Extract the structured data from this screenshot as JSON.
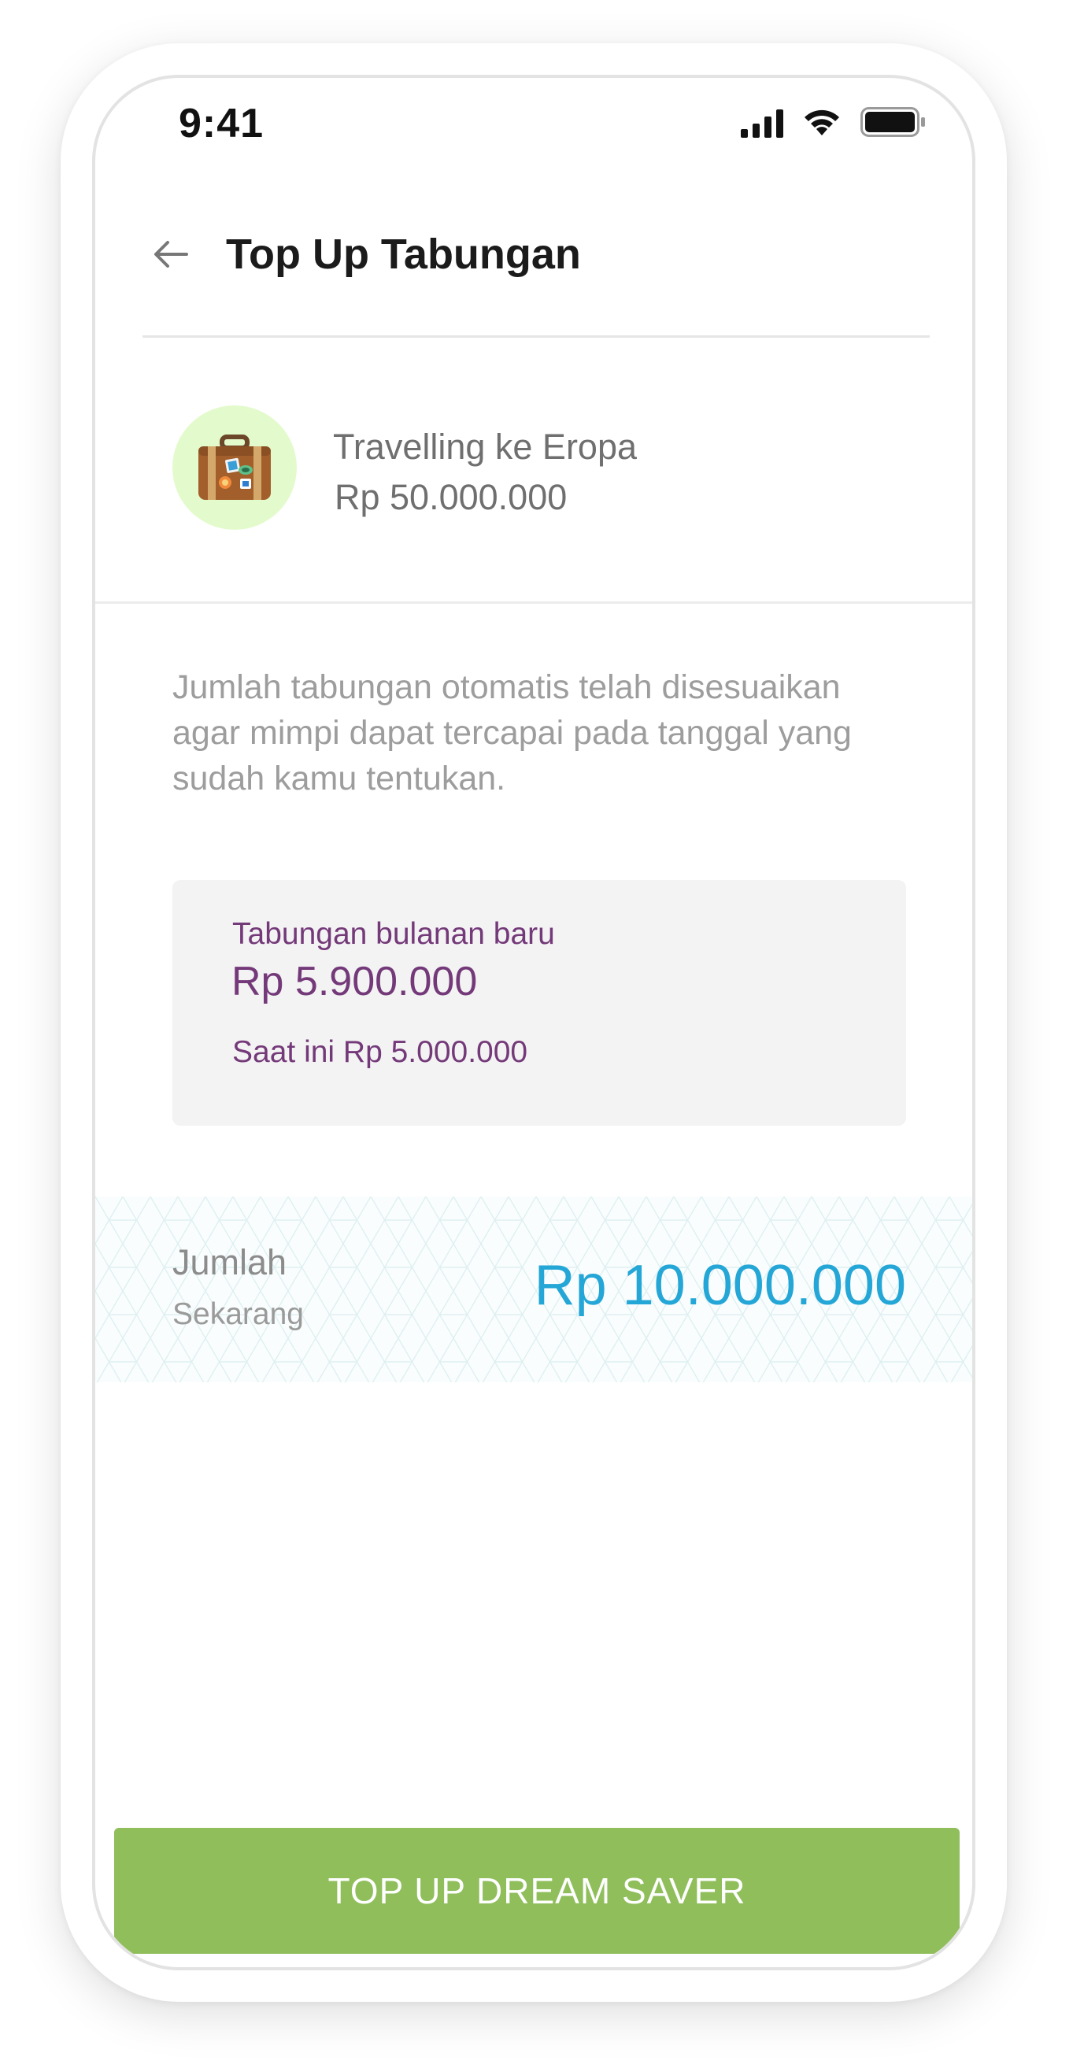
{
  "status_bar": {
    "time": "9:41",
    "icons": [
      "signal-icon",
      "wifi-icon",
      "battery-icon"
    ]
  },
  "header": {
    "back_icon": "arrow-left-icon",
    "title": "Top Up Tabungan"
  },
  "goal": {
    "icon": "suitcase-icon",
    "name": "Travelling ke Eropa",
    "amount": "Rp 50.000.000"
  },
  "info": {
    "text": "Jumlah tabungan otomatis telah disesuaikan agar mimpi dapat tercapai pada tanggal yang sudah kamu tentukan."
  },
  "savings_card": {
    "label": "Tabungan bulanan baru",
    "value": "Rp 5.900.000",
    "current": "Saat ini Rp 5.000.000"
  },
  "amount_now": {
    "label": "Jumlah",
    "sublabel": "Sekarang",
    "value": "Rp 10.000.000"
  },
  "action": {
    "button_label": "TOP UP DREAM SAVER"
  },
  "colors": {
    "accent_green": "#8fbe5b",
    "purple": "#743979",
    "blue": "#24a6d6",
    "avatar_bg": "#e3fbcc"
  }
}
